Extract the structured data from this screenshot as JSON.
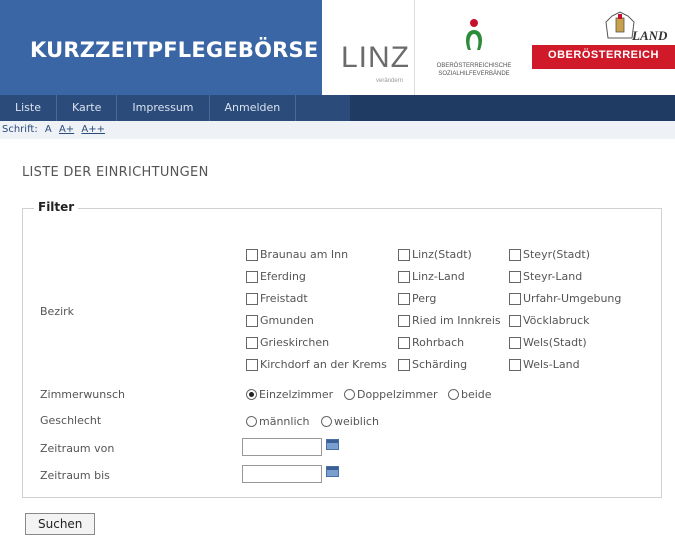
{
  "header": {
    "brand": "KURZZEITPFLEGEBÖRSE OÖ",
    "linz_logo": "LINZ",
    "linz_sub": "verändern",
    "sozial_line1": "OBERÖSTERREICHISCHE",
    "sozial_line2": "SOZIALHILFEVERBÄNDE",
    "land_word": "LAND",
    "land_name": "OBERÖSTERREICH",
    "brand_color": "#3b66a5",
    "land_color": "#d01a2a"
  },
  "nav": {
    "items": [
      "Liste",
      "Karte",
      "Impressum",
      "Anmelden"
    ]
  },
  "fontsize": {
    "label": "Schrift:",
    "options": [
      "A",
      "A+",
      "A++"
    ]
  },
  "page": {
    "title": "LISTE DER EINRICHTUNGEN"
  },
  "filter": {
    "legend": "Filter",
    "bezirk_label": "Bezirk",
    "bezirke": [
      "Braunau am Inn",
      "Linz(Stadt)",
      "Steyr(Stadt)",
      "Eferding",
      "Linz-Land",
      "Steyr-Land",
      "Freistadt",
      "Perg",
      "Urfahr-Umgebung",
      "Gmunden",
      "Ried im Innkreis",
      "Vöcklabruck",
      "Grieskirchen",
      "Rohrbach",
      "Wels(Stadt)",
      "Kirchdorf an der Krems",
      "Schärding",
      "Wels-Land"
    ],
    "zimmer_label": "Zimmerwunsch",
    "zimmer_options": [
      "Einzelzimmer",
      "Doppelzimmer",
      "beide"
    ],
    "zimmer_selected": "Einzelzimmer",
    "geschlecht_label": "Geschlecht",
    "geschlecht_options": [
      "männlich",
      "weiblich"
    ],
    "von_label": "Zeitraum von",
    "bis_label": "Zeitraum bis",
    "von_value": "",
    "bis_value": ""
  },
  "actions": {
    "search_label": "Suchen"
  }
}
